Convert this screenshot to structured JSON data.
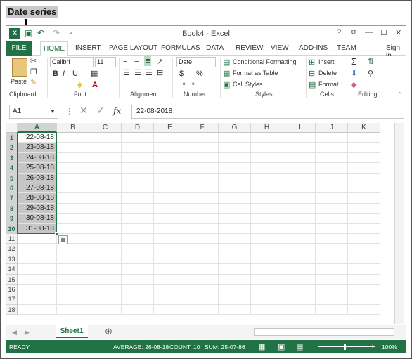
{
  "callout": {
    "title": "Date series"
  },
  "window": {
    "title": "Book4 - Excel",
    "help": "?",
    "restore": "⧉",
    "minimize": "—",
    "maximize": "☐",
    "close": "✕"
  },
  "qat": {
    "app_icon": "X",
    "undo": "↶",
    "redo": "↷",
    "customize": "⌄"
  },
  "ribbon_tabs": {
    "file": "FILE",
    "home": "HOME",
    "insert": "INSERT",
    "page_layout": "PAGE LAYOUT",
    "formulas": "FORMULAS",
    "data": "DATA",
    "review": "REVIEW",
    "view": "VIEW",
    "addins": "ADD-INS",
    "team": "TEAM",
    "sign_in": "Sign in"
  },
  "ribbon": {
    "clipboard": {
      "label": "Clipboard",
      "paste": "Paste"
    },
    "font": {
      "label": "Font",
      "name": "Calibri",
      "size": "11",
      "bold": "B",
      "italic": "I",
      "underline": "U"
    },
    "alignment": {
      "label": "Alignment"
    },
    "number": {
      "label": "Number",
      "format": "Date",
      "currency": "$",
      "percent": "%",
      "comma": ","
    },
    "styles": {
      "label": "Styles",
      "conditional": "Conditional Formatting",
      "format_table": "Format as Table",
      "cell_styles": "Cell Styles"
    },
    "cells": {
      "label": "Cells",
      "insert": "Insert",
      "delete": "Delete",
      "format": "Format"
    },
    "editing": {
      "label": "Editing",
      "sum": "Σ"
    }
  },
  "formula_bar": {
    "name_box": "A1",
    "fx": "fx",
    "value": "22-08-2018"
  },
  "sheet": {
    "columns": [
      "A",
      "B",
      "C",
      "D",
      "E",
      "F",
      "G",
      "H",
      "I",
      "J",
      "K"
    ],
    "rows": [
      "1",
      "2",
      "3",
      "4",
      "5",
      "6",
      "7",
      "8",
      "9",
      "10",
      "11",
      "12",
      "13",
      "14",
      "15",
      "16",
      "17",
      "18"
    ],
    "values": [
      "22-08-18",
      "23-08-18",
      "24-08-18",
      "25-08-18",
      "26-08-18",
      "27-08-18",
      "28-08-18",
      "29-08-18",
      "30-08-18",
      "31-08-18"
    ]
  },
  "sheet_tabs": {
    "active": "Sheet1",
    "add": "⊕"
  },
  "status": {
    "mode": "READY",
    "average": "AVERAGE: 26-08-18",
    "count": "COUNT: 10",
    "sum": "SUM: 25-07-86",
    "zoom": "100%"
  },
  "colors": {
    "brand": "#217346"
  }
}
